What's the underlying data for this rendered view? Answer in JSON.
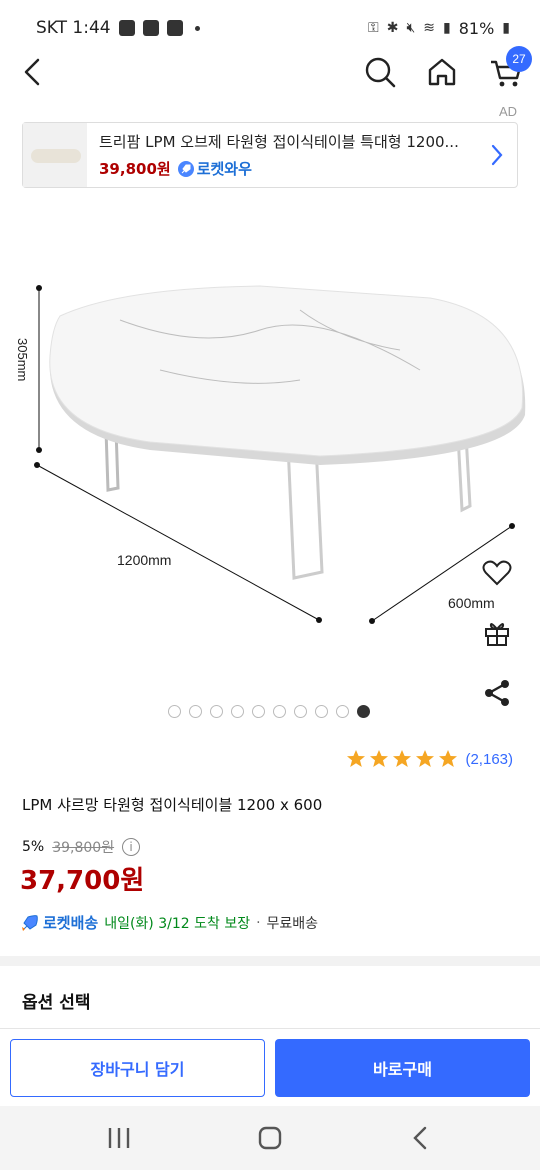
{
  "status_bar": {
    "carrier_time": "SKT 1:44",
    "battery": "81%"
  },
  "top_nav": {
    "cart_count": "27",
    "icons": [
      "back-icon",
      "search-icon",
      "home-icon",
      "cart-icon"
    ]
  },
  "ad": {
    "label": "AD",
    "title": "트리팜 LPM 오브제 타원형 접이식테이블 특대형 1200...",
    "price": "39,800원",
    "rocket_label": "로켓와우"
  },
  "product_image": {
    "height_label": "305mm",
    "length_label": "1200mm",
    "width_label": "600mm",
    "slide_count": 10,
    "active_slide": 9
  },
  "side_actions": [
    "heart-icon",
    "gift-icon",
    "share-icon"
  ],
  "rating": {
    "stars": 5,
    "review_count": "(2,163)"
  },
  "product": {
    "title": "LPM 샤르망 타원형 접이식테이블 1200 x 600",
    "discount_rate": "5%",
    "original_price": "39,800원",
    "sale_price": "37,700원",
    "info_glyph": "i"
  },
  "delivery": {
    "rocket_label": "로켓배송",
    "arrival": "내일(화) 3/12 도착 보장",
    "separator": "·",
    "shipping": "무료배송"
  },
  "options": {
    "title": "옵션 선택"
  },
  "bottom_bar": {
    "cart_label": "장바구니 담기",
    "buy_label": "바로구매"
  },
  "colors": {
    "accent": "#346aff",
    "price_red": "#ae0000",
    "rocket_blue": "#1d6fd6",
    "arrival_green": "#00891a",
    "star_yellow": "#f5a623"
  }
}
